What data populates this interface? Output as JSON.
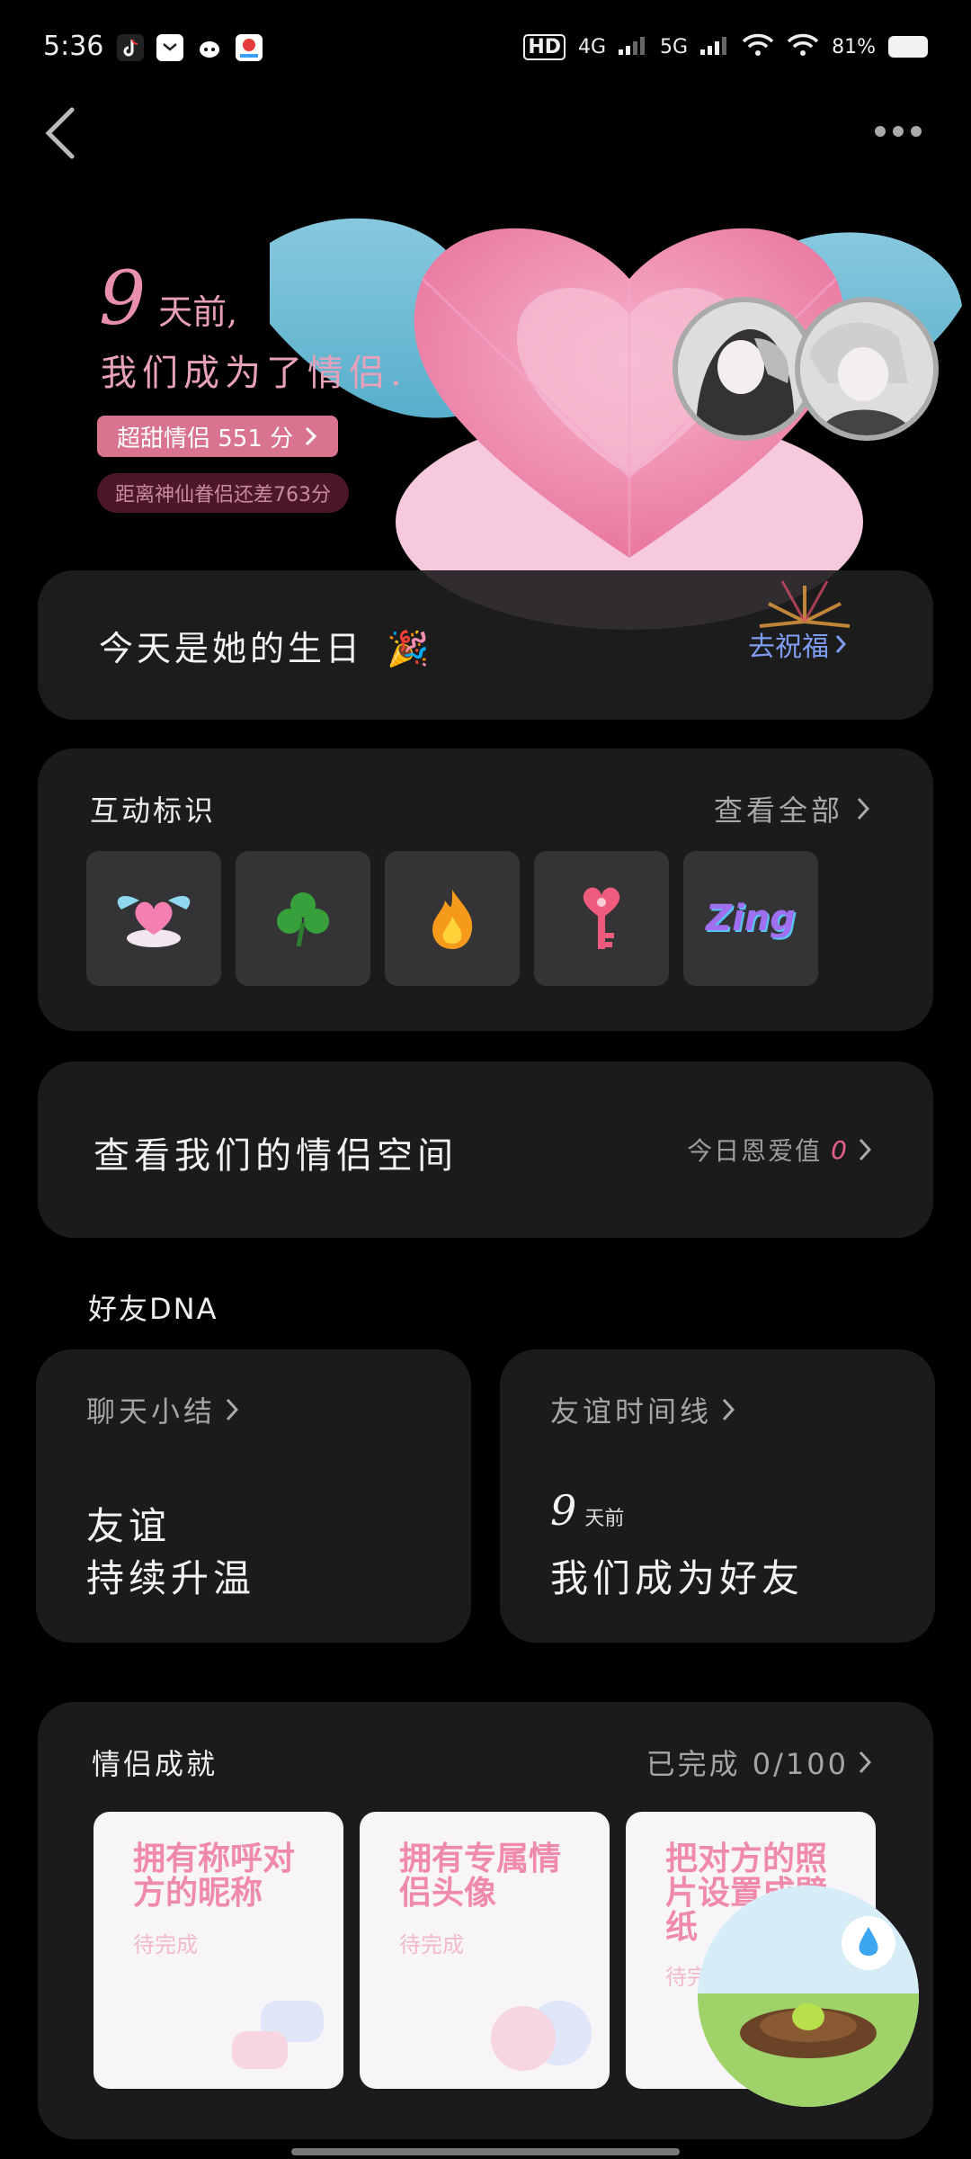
{
  "status_bar": {
    "time": "5:36",
    "network_1": "4G",
    "network_2": "5G",
    "hd_label": "HD",
    "battery": "81%",
    "icons": [
      "tiktok-icon",
      "mail-icon",
      "cat-app-icon",
      "map-app-icon",
      "hd-icon",
      "signal-icon",
      "wifi-icon",
      "battery-icon"
    ]
  },
  "nav": {
    "back_icon": "chevron-left-icon",
    "more_icon": "more-dots-icon"
  },
  "hero": {
    "days_number": "9",
    "days_unit": "天前,",
    "became": "我们成为了情侣.",
    "score_label": "超甜情侣  551 分",
    "gap_label": "距离神仙眷侣还差763分",
    "colors": {
      "accent": "#e88fab",
      "pill": "#d9748f"
    }
  },
  "birthday": {
    "text": "今天是她的生日",
    "emoji": "🎉",
    "link": "去祝福"
  },
  "interaction_tags": {
    "title": "互动标识",
    "see_all": "查看全部",
    "tags": [
      {
        "name": "heart-wings-icon"
      },
      {
        "name": "clover-icon"
      },
      {
        "name": "fire-icon"
      },
      {
        "name": "heart-key-icon"
      },
      {
        "name": "zing-icon",
        "label": "Zing"
      }
    ]
  },
  "couple_space": {
    "title": "查看我们的情侣空间",
    "love_label": "今日恩爱值",
    "love_value": "0"
  },
  "friend_dna": {
    "title": "好友DNA",
    "chat_summary": {
      "head": "聊天小结",
      "line1": "友谊",
      "line2": "持续升温"
    },
    "timeline": {
      "head": "友谊时间线",
      "days_num": "9",
      "days_unit": "天前",
      "line2": "我们成为好友"
    }
  },
  "achievements": {
    "title": "情侣成就",
    "progress": "已完成 0/100",
    "items": [
      {
        "title": "拥有称呼对方的昵称",
        "status": "待完成"
      },
      {
        "title": "拥有专属情侣头像",
        "status": "待完成"
      },
      {
        "title": "把对方的照片设置成壁纸",
        "status": "待完成"
      }
    ]
  }
}
